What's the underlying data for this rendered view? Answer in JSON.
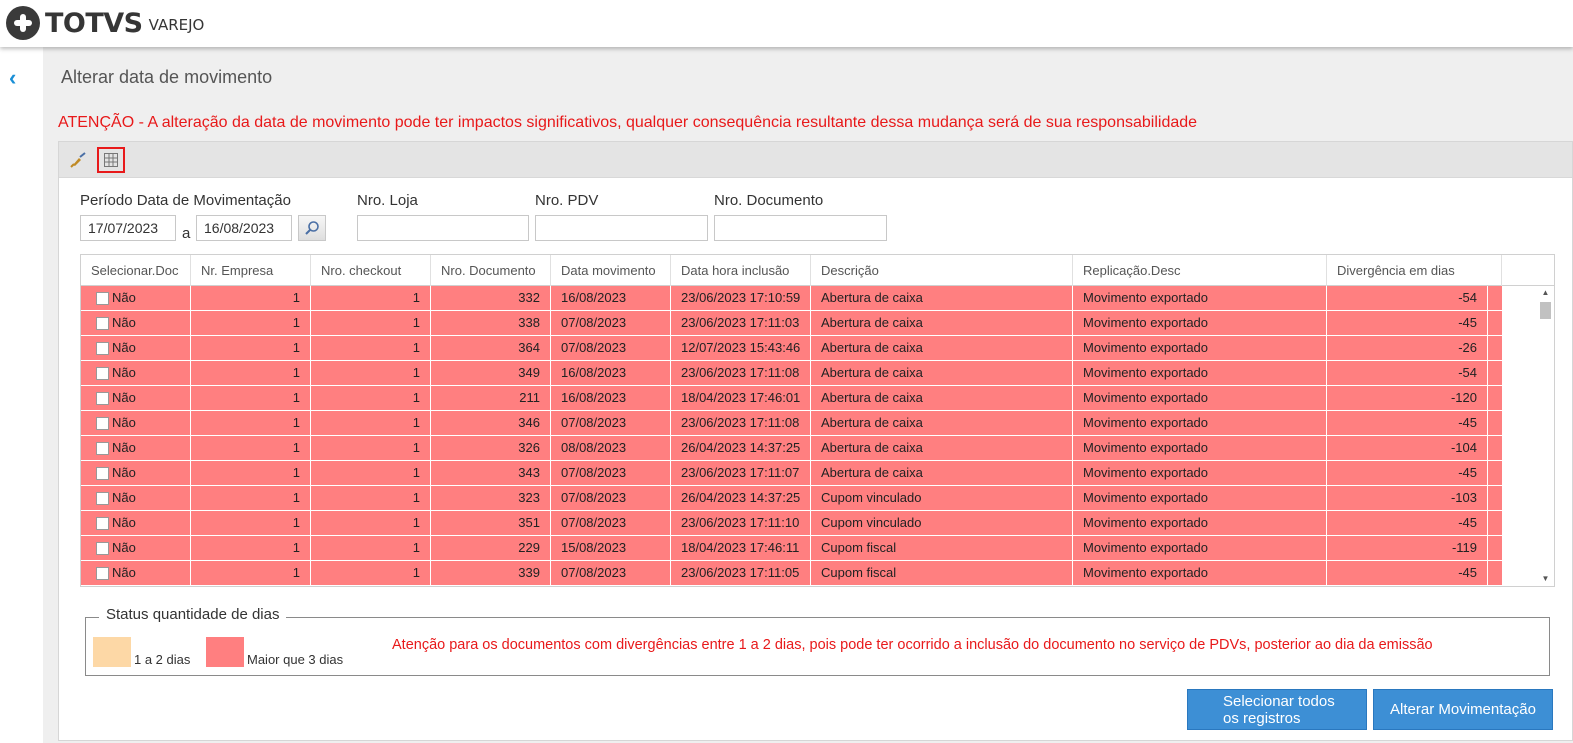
{
  "app": {
    "brand": "TOTVS",
    "product": "VAREJO"
  },
  "page": {
    "title": "Alterar data de movimento",
    "warning": "ATENÇÃO - A alteração da data de movimento pode ter impactos significativos, qualquer consequência resultante dessa mudança será de sua responsabilidade"
  },
  "toolbar": {
    "clean_icon": "broom-icon",
    "grid_icon": "grid-icon"
  },
  "filters": {
    "period_label": "Período Data de Movimentação",
    "date_from": "17/07/2023",
    "separator": "a",
    "date_to": "16/08/2023",
    "loja_label": "Nro. Loja",
    "loja_value": "",
    "pdv_label": "Nro. PDV",
    "pdv_value": "",
    "doc_label": "Nro. Documento",
    "doc_value": ""
  },
  "grid": {
    "columns": [
      "Selecionar.Doc",
      "Nr. Empresa",
      "Nro. checkout",
      "Nro. Documento",
      "Data movimento",
      "Data hora inclusão",
      "Descrição",
      "Replicação.Desc",
      "Divergência em dias"
    ],
    "rows": [
      [
        "Não",
        "1",
        "1",
        "332",
        "16/08/2023",
        "23/06/2023 17:10:59",
        "Abertura de caixa",
        "Movimento exportado",
        "-54"
      ],
      [
        "Não",
        "1",
        "1",
        "338",
        "07/08/2023",
        "23/06/2023 17:11:03",
        "Abertura de caixa",
        "Movimento exportado",
        "-45"
      ],
      [
        "Não",
        "1",
        "1",
        "364",
        "07/08/2023",
        "12/07/2023 15:43:46",
        "Abertura de caixa",
        "Movimento exportado",
        "-26"
      ],
      [
        "Não",
        "1",
        "1",
        "349",
        "16/08/2023",
        "23/06/2023 17:11:08",
        "Abertura de caixa",
        "Movimento exportado",
        "-54"
      ],
      [
        "Não",
        "1",
        "1",
        "211",
        "16/08/2023",
        "18/04/2023 17:46:01",
        "Abertura de caixa",
        "Movimento exportado",
        "-120"
      ],
      [
        "Não",
        "1",
        "1",
        "346",
        "07/08/2023",
        "23/06/2023 17:11:08",
        "Abertura de caixa",
        "Movimento exportado",
        "-45"
      ],
      [
        "Não",
        "1",
        "1",
        "326",
        "08/08/2023",
        "26/04/2023 14:37:25",
        "Abertura de caixa",
        "Movimento exportado",
        "-104"
      ],
      [
        "Não",
        "1",
        "1",
        "343",
        "07/08/2023",
        "23/06/2023 17:11:07",
        "Abertura de caixa",
        "Movimento exportado",
        "-45"
      ],
      [
        "Não",
        "1",
        "1",
        "323",
        "07/08/2023",
        "26/04/2023 14:37:25",
        "Cupom vinculado",
        "Movimento exportado",
        "-103"
      ],
      [
        "Não",
        "1",
        "1",
        "351",
        "07/08/2023",
        "23/06/2023 17:11:10",
        "Cupom vinculado",
        "Movimento exportado",
        "-45"
      ],
      [
        "Não",
        "1",
        "1",
        "229",
        "15/08/2023",
        "18/04/2023 17:46:11",
        "Cupom fiscal",
        "Movimento exportado",
        "-119"
      ],
      [
        "Não",
        "1",
        "1",
        "339",
        "07/08/2023",
        "23/06/2023 17:11:05",
        "Cupom fiscal",
        "Movimento exportado",
        "-45"
      ]
    ]
  },
  "legend": {
    "title": "Status quantidade de dias",
    "item1": "1 a 2 dias",
    "item1_color": "#fdd8a6",
    "item2": "Maior que 3 dias",
    "item2_color": "#ff7f80",
    "note": "Atenção para os documentos com divergências entre 1 a 2 dias, pois pode ter ocorrido a inclusão do documento no serviço de PDVs, posterior ao dia da emissão"
  },
  "actions": {
    "select_all_line1": "Selecionar todos",
    "select_all_line2": "os registros",
    "alter": "Alterar Movimentação"
  }
}
